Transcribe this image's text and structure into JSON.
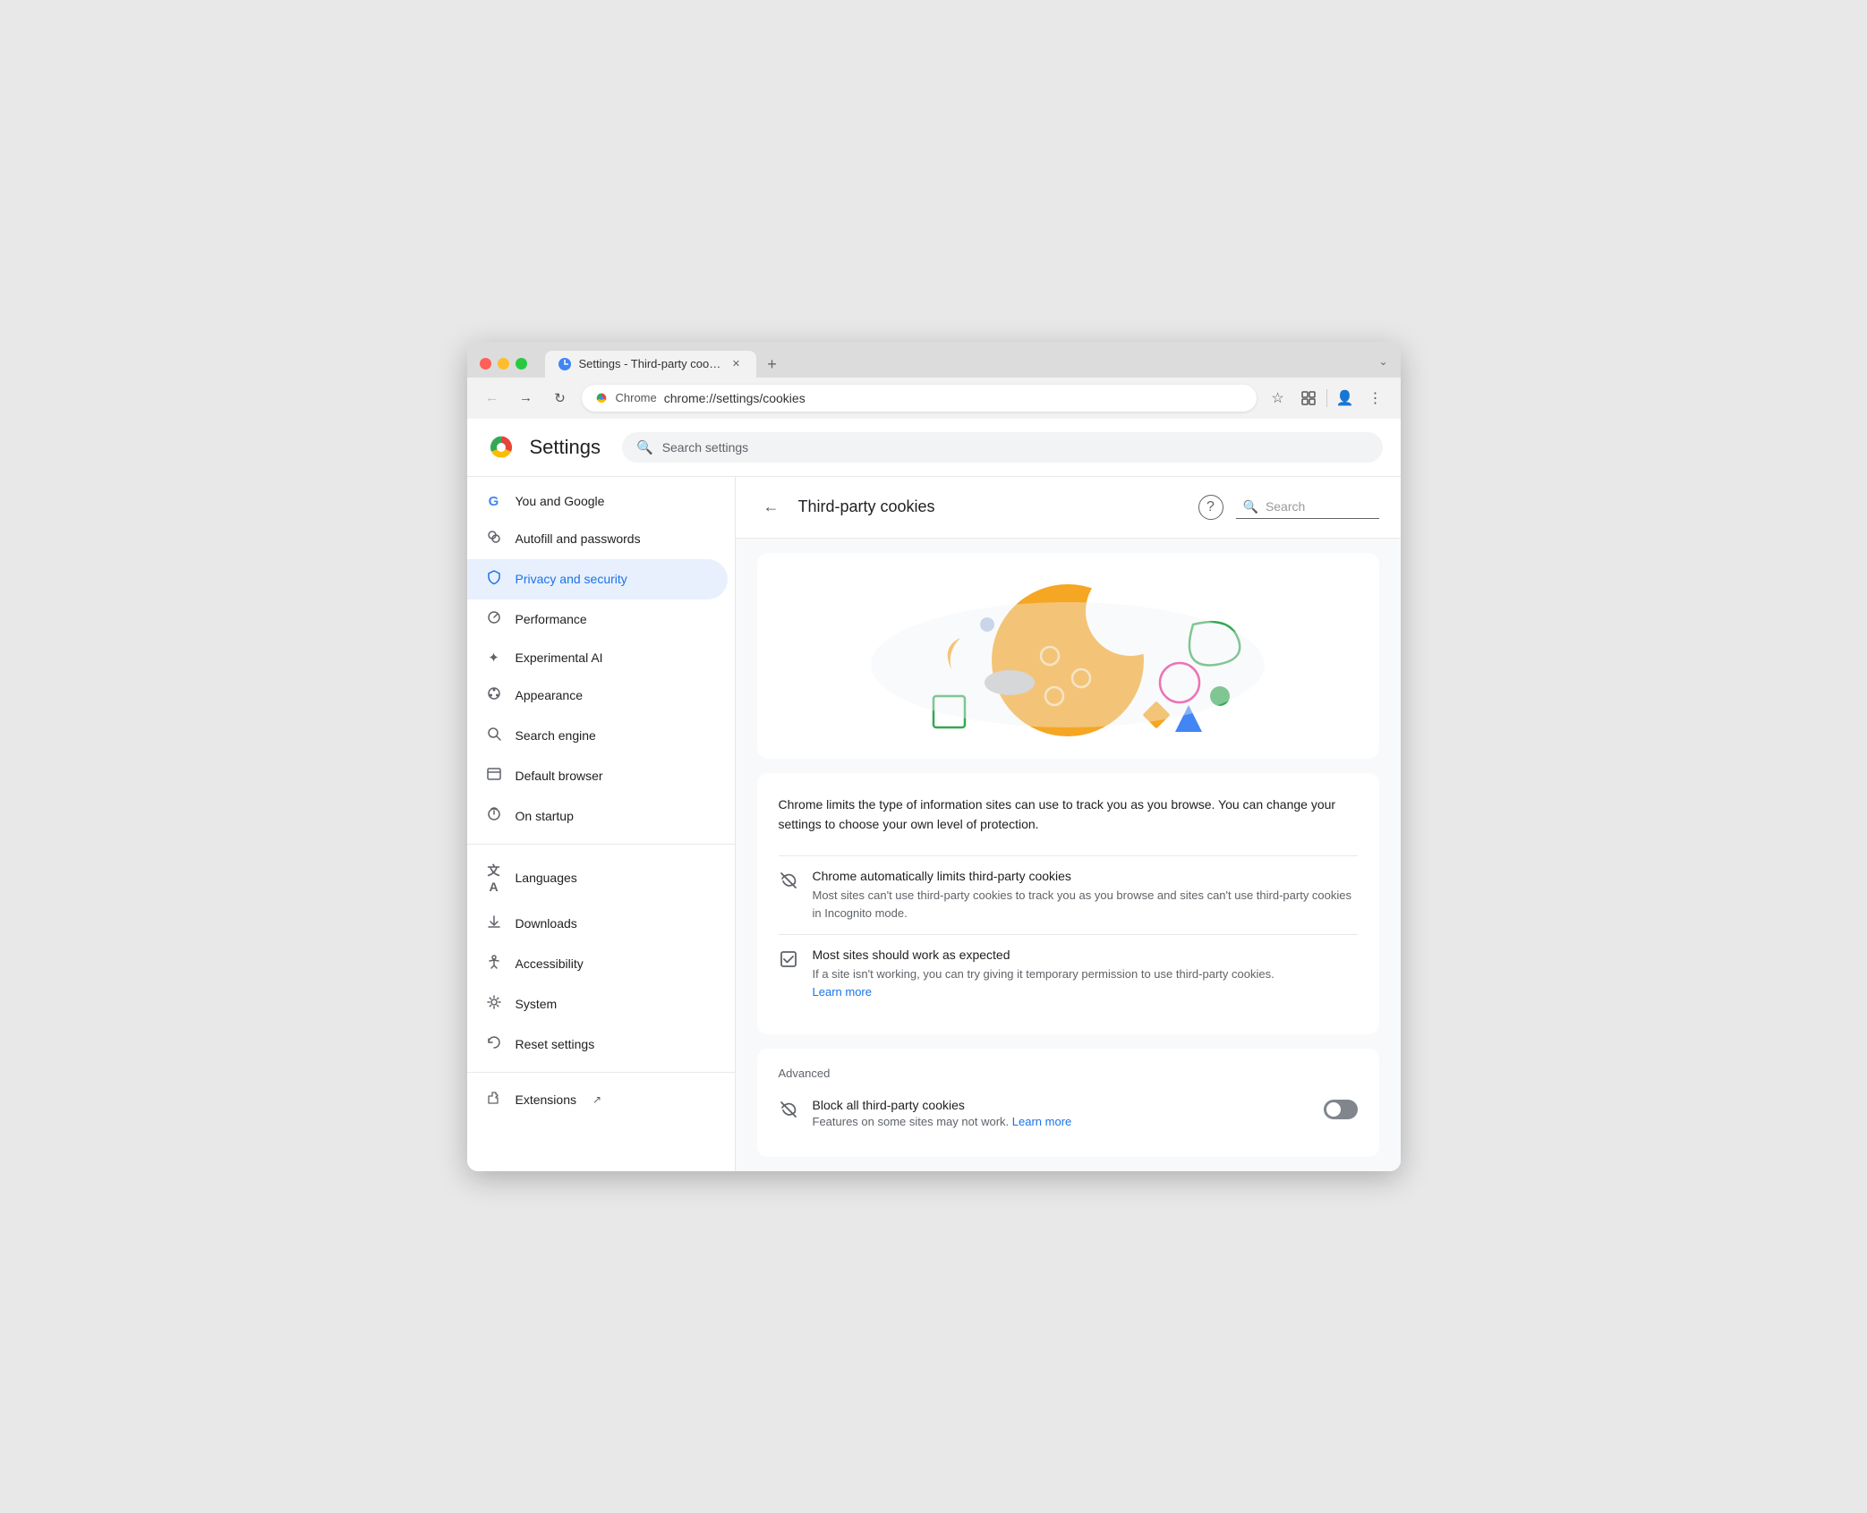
{
  "browser": {
    "tab": {
      "title": "Settings - Third-party cookie",
      "favicon": "⚙️"
    },
    "address": "chrome://settings/cookies",
    "address_label": "Chrome"
  },
  "settings": {
    "title": "Settings",
    "search_placeholder": "Search settings",
    "sidebar": {
      "items": [
        {
          "id": "you-and-google",
          "label": "You and Google",
          "icon": "G"
        },
        {
          "id": "autofill",
          "label": "Autofill and passwords",
          "icon": "🔑"
        },
        {
          "id": "privacy",
          "label": "Privacy and security",
          "icon": "🛡",
          "active": true
        },
        {
          "id": "performance",
          "label": "Performance",
          "icon": "⏱"
        },
        {
          "id": "experimental-ai",
          "label": "Experimental AI",
          "icon": "✦"
        },
        {
          "id": "appearance",
          "label": "Appearance",
          "icon": "🎨"
        },
        {
          "id": "search-engine",
          "label": "Search engine",
          "icon": "🔍"
        },
        {
          "id": "default-browser",
          "label": "Default browser",
          "icon": "⬜"
        },
        {
          "id": "on-startup",
          "label": "On startup",
          "icon": "⏻"
        }
      ],
      "items2": [
        {
          "id": "languages",
          "label": "Languages",
          "icon": "文"
        },
        {
          "id": "downloads",
          "label": "Downloads",
          "icon": "⬇"
        },
        {
          "id": "accessibility",
          "label": "Accessibility",
          "icon": "♿"
        },
        {
          "id": "system",
          "label": "System",
          "icon": "🔧"
        },
        {
          "id": "reset",
          "label": "Reset settings",
          "icon": "↺"
        }
      ],
      "items3": [
        {
          "id": "extensions",
          "label": "Extensions",
          "icon": "🧩",
          "external": true
        }
      ]
    }
  },
  "content": {
    "back_label": "←",
    "title": "Third-party cookies",
    "search_placeholder": "Search",
    "description": "Chrome limits the type of information sites can use to track you as you browse. You can change your settings to choose your own level of protection.",
    "options": [
      {
        "id": "auto-limit",
        "title": "Chrome automatically limits third-party cookies",
        "desc": "Most sites can't use third-party cookies to track you as you browse and sites can't use third-party cookies in Incognito mode.",
        "icon": "eye-off"
      },
      {
        "id": "most-sites",
        "title": "Most sites should work as expected",
        "desc": "If a site isn't working, you can try giving it temporary permission to use third-party cookies.",
        "learn_more": "Learn more",
        "icon": "checkbox"
      }
    ],
    "advanced_label": "Advanced",
    "advanced_options": [
      {
        "id": "block-all",
        "title": "Block all third-party cookies",
        "desc": "Features on some sites may not work.",
        "learn_more": "Learn more",
        "icon": "eye-off",
        "toggle": false
      }
    ],
    "learn_more_url": "#",
    "learn_more_label": "Learn more"
  }
}
